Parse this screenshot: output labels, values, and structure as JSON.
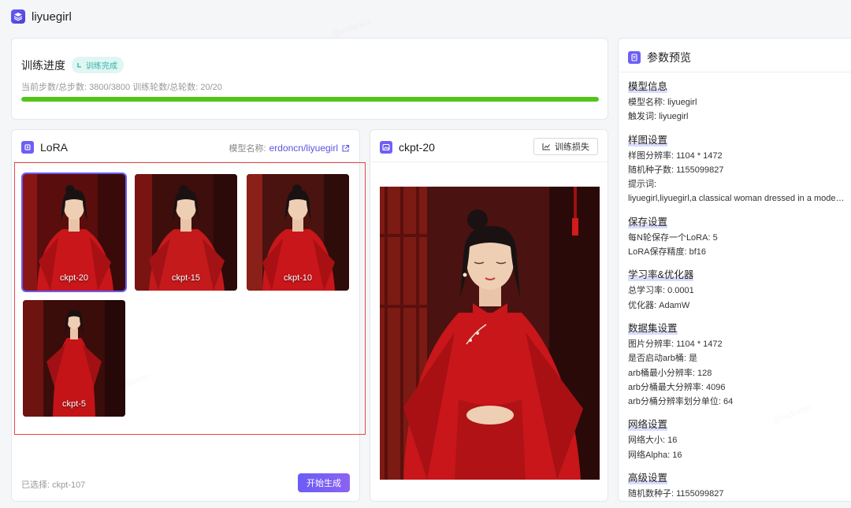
{
  "app": {
    "title": "liyuegirl"
  },
  "progress": {
    "title": "训练进度",
    "status_badge": "训练完成",
    "stats": "当前步数/总步数: 3800/3800  训练轮数/总轮数: 20/20",
    "percent": 100,
    "bar_color": "#52c41a"
  },
  "lora": {
    "title": "LoRA",
    "model_name_label": "模型名称:",
    "model_name_link": "erdoncn/liyuegirl",
    "checkpoints": [
      {
        "label": "ckpt-20",
        "selected": true
      },
      {
        "label": "ckpt-15",
        "selected": false
      },
      {
        "label": "ckpt-10",
        "selected": false
      },
      {
        "label": "ckpt-5",
        "selected": false
      }
    ],
    "selected_text": "已选择: ckpt-107",
    "generate_button": "开始生成"
  },
  "preview": {
    "title": "ckpt-20",
    "loss_button": "训练损失"
  },
  "params": {
    "title": "参数预览",
    "sections": [
      {
        "title": "模型信息",
        "items": [
          "模型名称: liyuegirl",
          "触发词: liyuegirl"
        ]
      },
      {
        "title": "样图设置",
        "items": [
          "样图分辨率: 1104 * 1472",
          "随机种子数: 1155099827",
          "提示词:",
          "liyuegirl,liyuegirl,a classical woman dressed in a modern red qipao"
        ]
      },
      {
        "title": "保存设置",
        "items": [
          "每N轮保存一个LoRA: 5",
          "LoRA保存精度: bf16"
        ]
      },
      {
        "title": "学习率&优化器",
        "items": [
          "总学习率: 0.0001",
          "优化器: AdamW"
        ]
      },
      {
        "title": "数据集设置",
        "items": [
          "图片分辨率: 1104 * 1472",
          "是否启动arb桶: 是",
          "arb桶最小分辨率: 128",
          "arb分桶最大分辨率: 4096",
          "arb分桶分辨率划分单位: 64"
        ]
      },
      {
        "title": "网络设置",
        "items": [
          "网络大小: 16",
          "网络Alpha: 16"
        ]
      },
      {
        "title": "高级设置",
        "items": [
          "随机数种子: 1155099827"
        ]
      }
    ]
  },
  "colors": {
    "accent": "#6b5cf6",
    "highlight_frame": "#e04848",
    "dress": "#c8161a"
  }
}
